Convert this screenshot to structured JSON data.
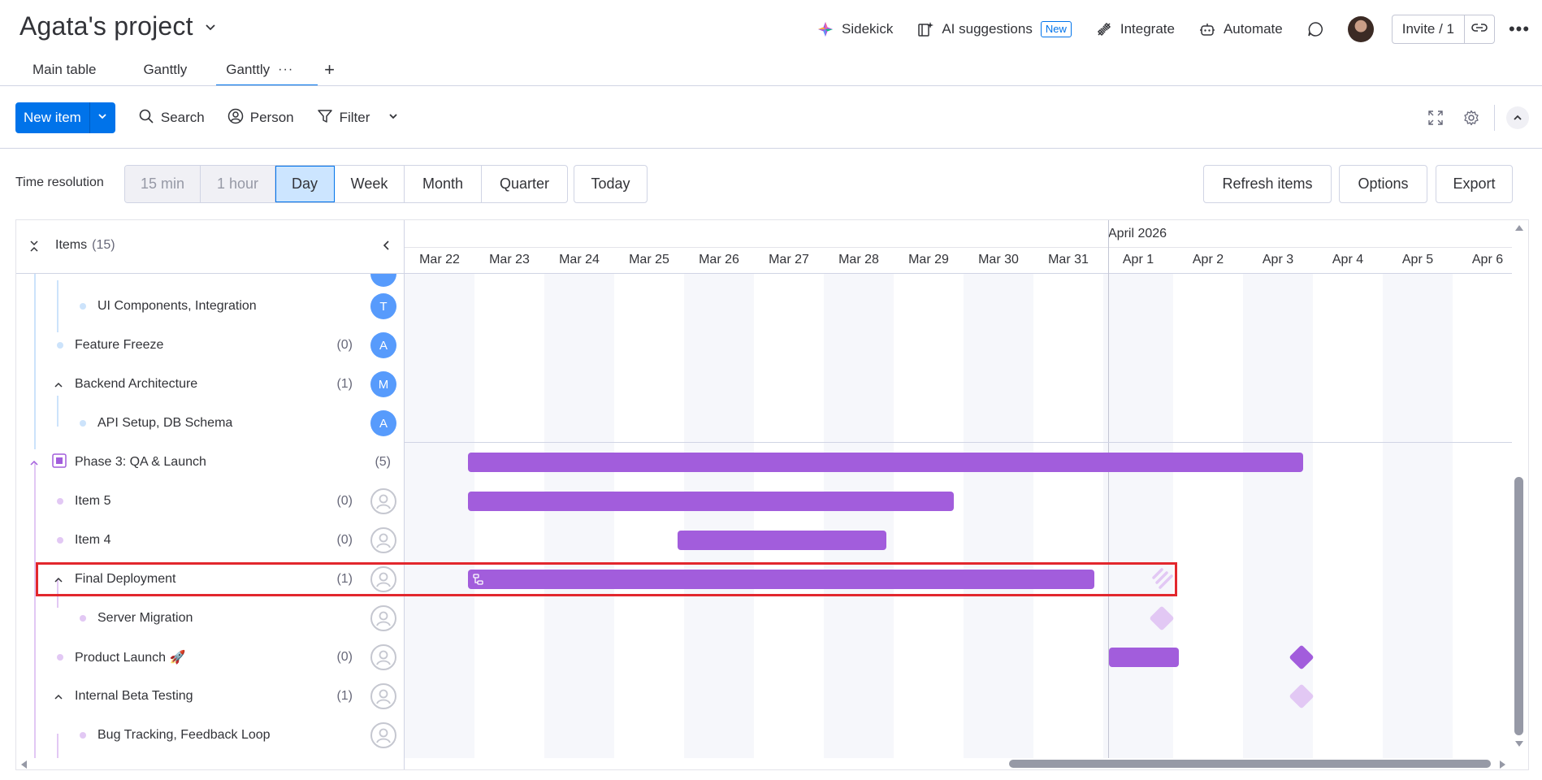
{
  "header": {
    "title": "Agata's project",
    "actions": {
      "sidekick": "Sidekick",
      "ai_suggestions": "AI suggestions",
      "new_badge": "New",
      "integrate": "Integrate",
      "automate": "Automate",
      "invite": "Invite / 1"
    }
  },
  "tabs": [
    {
      "label": "Main table"
    },
    {
      "label": "Ganttly"
    },
    {
      "label": "Ganttly"
    }
  ],
  "toolbar": {
    "new_item": "New item",
    "search": "Search",
    "person": "Person",
    "filter": "Filter"
  },
  "time_resolution": {
    "label": "Time resolution",
    "options": [
      "15 min",
      "1 hour",
      "Day",
      "Week",
      "Month",
      "Quarter"
    ],
    "selected": "Day",
    "today": "Today",
    "refresh": "Refresh items",
    "options_btn": "Options",
    "export": "Export"
  },
  "gantt": {
    "items_label": "Items",
    "items_count": "(15)",
    "month_label": "April 2026",
    "days": [
      "Mar 22",
      "Mar 23",
      "Mar 24",
      "Mar 25",
      "Mar 26",
      "Mar 27",
      "Mar 28",
      "Mar 29",
      "Mar 30",
      "Mar 31",
      "Apr 1",
      "Apr 2",
      "Apr 3",
      "Apr 4",
      "Apr 5",
      "Apr 6"
    ],
    "rows": [
      {
        "name": "UI Components, Integration",
        "count": "",
        "avatar": "T"
      },
      {
        "name": "Feature Freeze",
        "count": "(0)",
        "avatar": "A"
      },
      {
        "name": "Backend Architecture",
        "count": "(1)",
        "avatar": "M"
      },
      {
        "name": "API Setup, DB Schema",
        "count": "",
        "avatar": "A"
      },
      {
        "name": "Phase 3: QA & Launch",
        "count": "(5)",
        "avatar": ""
      },
      {
        "name": "Item 5",
        "count": "(0)",
        "avatar": ""
      },
      {
        "name": "Item 4",
        "count": "(0)",
        "avatar": ""
      },
      {
        "name": "Final Deployment",
        "count": "(1)",
        "avatar": ""
      },
      {
        "name": "Server Migration",
        "count": "",
        "avatar": ""
      },
      {
        "name": "Product Launch 🚀",
        "count": "(0)",
        "avatar": ""
      },
      {
        "name": "Internal Beta Testing",
        "count": "(1)",
        "avatar": ""
      },
      {
        "name": "Bug Tracking, Feedback Loop",
        "count": "",
        "avatar": ""
      }
    ]
  },
  "colors": {
    "accent": "#0073ea",
    "bar": "#a25ddc",
    "bar_light": "#e2c8f4",
    "avatar_blue": "#579bfc",
    "highlight": "#e2272d"
  }
}
